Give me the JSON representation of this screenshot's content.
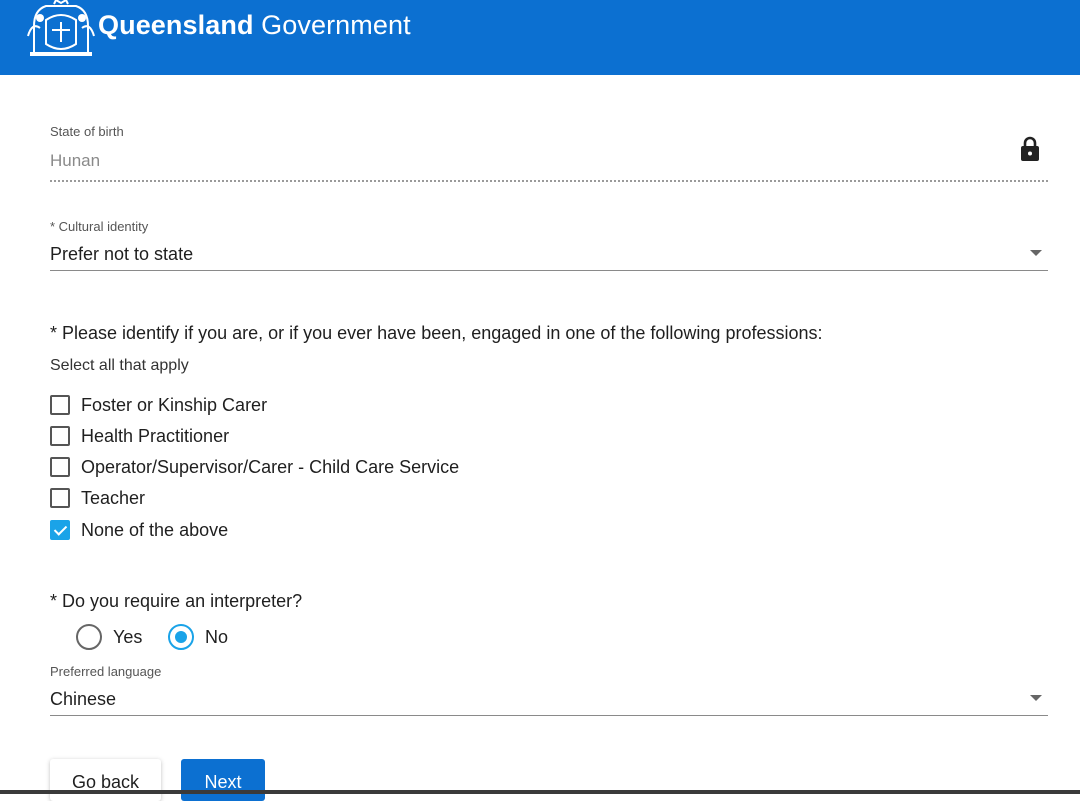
{
  "header": {
    "brand_bold": "Queensland",
    "brand_rest": "Government"
  },
  "state_of_birth": {
    "label": "State of birth",
    "value": "Hunan"
  },
  "cultural_identity": {
    "label": "* Cultural identity",
    "value": "Prefer not to state"
  },
  "professions": {
    "question": "* Please identify if you are, or if you ever have been, engaged in one of the following professions:",
    "helper": "Select all that apply",
    "options": [
      {
        "label": "Foster or Kinship Carer",
        "checked": false
      },
      {
        "label": "Health Practitioner",
        "checked": false
      },
      {
        "label": "Operator/Supervisor/Carer - Child Care Service",
        "checked": false
      },
      {
        "label": "Teacher",
        "checked": false
      },
      {
        "label": "None of the above",
        "checked": true
      }
    ]
  },
  "interpreter": {
    "question": "* Do you require an interpreter?",
    "options": [
      {
        "label": "Yes",
        "selected": false
      },
      {
        "label": "No",
        "selected": true
      }
    ]
  },
  "preferred_language": {
    "label": "Preferred language",
    "value": "Chinese"
  },
  "buttons": {
    "back": "Go back",
    "next": "Next"
  },
  "colors": {
    "header_bg": "#0c70d1",
    "accent": "#1aa3e8"
  }
}
